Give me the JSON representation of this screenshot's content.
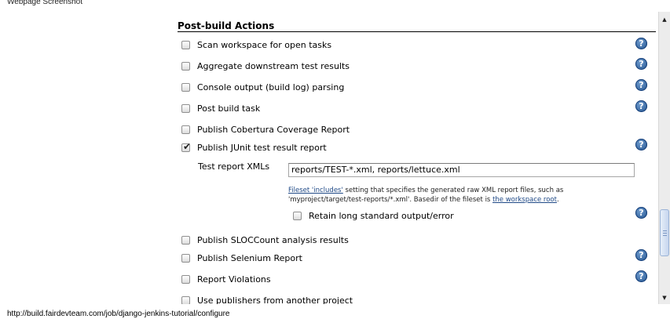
{
  "window": {
    "title": "Webpage Screenshot"
  },
  "section": {
    "title": "Post-build Actions"
  },
  "actions": [
    {
      "label": "Scan workspace for open tasks",
      "checked": false,
      "help": true
    },
    {
      "label": "Aggregate downstream test results",
      "checked": false,
      "help": true
    },
    {
      "label": "Console output (build log) parsing",
      "checked": false,
      "help": true
    },
    {
      "label": "Post build task",
      "checked": false,
      "help": true
    },
    {
      "label": "Publish Cobertura Coverage Report",
      "checked": false,
      "help": false
    },
    {
      "label": "Publish JUnit test result report",
      "checked": true,
      "help": true
    },
    {
      "label": "Publish SLOCCount analysis results",
      "checked": false,
      "help": false
    },
    {
      "label": "Publish Selenium Report",
      "checked": false,
      "help": true
    },
    {
      "label": "Report Violations",
      "checked": false,
      "help": true
    },
    {
      "label": "Use publishers from another project",
      "checked": false,
      "help": false
    }
  ],
  "junit": {
    "field_label": "Test report XMLs",
    "field_value": "reports/TEST-*.xml, reports/lettuce.xml",
    "desc_link1": "Fileset 'includes'",
    "desc_text1": " setting that specifies the generated raw XML report files, such as 'myproject/target/test-reports/*.xml'. Basedir of the fileset is ",
    "desc_link2": "the workspace root",
    "desc_text2": ".",
    "retain_label": "Retain long standard output/error",
    "retain_checked": false
  },
  "help_icon": {
    "glyph": "?",
    "color": "#2a5a98"
  },
  "status_bar": {
    "url": "http://build.fairdevteam.com/job/django-jenkins-tutorial/configure"
  },
  "icons": {
    "checkbox_tick": "✔",
    "scroll_up": "▲",
    "scroll_down": "▼"
  }
}
